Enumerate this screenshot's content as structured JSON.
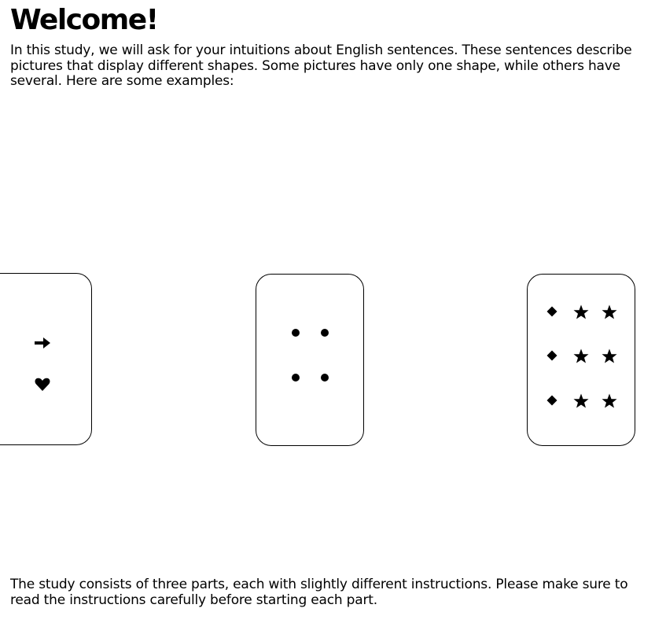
{
  "header": {
    "title": "Welcome!"
  },
  "intro": {
    "text": "In this study, we will ask for your intuitions about English sentences. These sentences describe pictures that display different shapes. Some pictures have only one shape, while others have several. Here are some examples:"
  },
  "examples": [
    {
      "shapes": [
        "arrow",
        "heart"
      ]
    },
    {
      "shapes": [
        "circle",
        "circle",
        "circle",
        "circle"
      ]
    },
    {
      "shapes": [
        "diamond",
        "star",
        "star",
        "diamond",
        "star",
        "star",
        "diamond",
        "star",
        "star"
      ]
    }
  ],
  "outro": {
    "text": "The study consists of three parts, each with slightly different instructions. Please make sure to read the instructions carefully before starting each part."
  },
  "colors": {
    "text": "#000000",
    "background": "#ffffff",
    "card_border": "#000000",
    "shape_fill": "#000000"
  }
}
